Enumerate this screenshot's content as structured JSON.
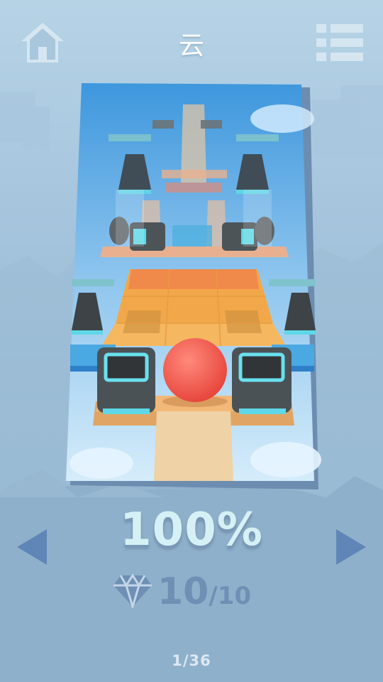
{
  "header": {
    "title": "云",
    "home_icon": "home-icon",
    "menu_icon": "list-menu-icon"
  },
  "level": {
    "completion_text": "100%",
    "completion_value": 1.0,
    "gems_collected": "10",
    "gems_total": "/10",
    "gem_icon": "diamond-icon"
  },
  "navigation": {
    "prev_icon": "arrow-left-icon",
    "next_icon": "arrow-right-icon",
    "page_indicator": "1/36"
  },
  "colors": {
    "background": "#a4c3dc",
    "accent_icon": "#5f86b7",
    "percent_text": "#d6f1f6",
    "gem_color": "#6f8fb5",
    "ball": "#f05a4f"
  }
}
